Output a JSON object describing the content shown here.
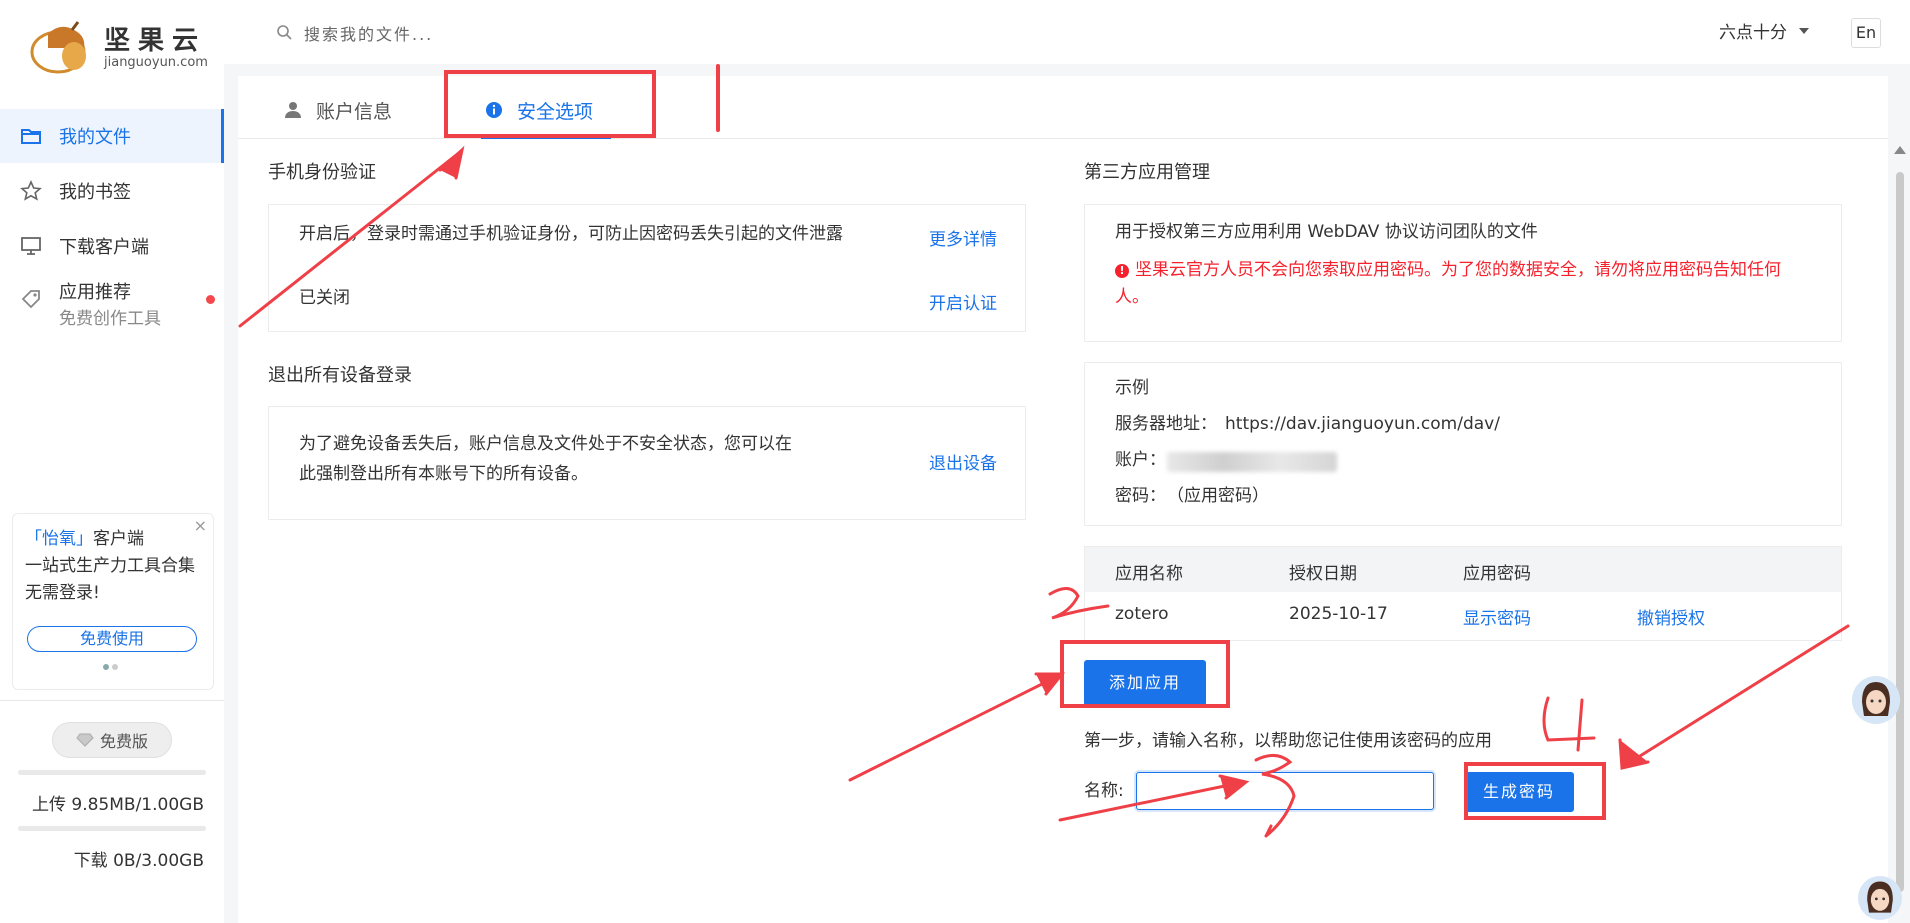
{
  "sidebar": {
    "logo": {
      "cn": "坚果云",
      "en": "jianguoyun.com"
    },
    "items": [
      {
        "label": "我的文件"
      },
      {
        "label": "我的书签"
      },
      {
        "label": "下载客户端"
      },
      {
        "label": "应用推荐",
        "sub": "免费创作工具"
      }
    ],
    "promo": {
      "highlight": "「怡氧」",
      "line1_rest": "客户端",
      "line2": "一站式生产力工具合集 无需登录!",
      "button": "免费使用",
      "close": "×"
    },
    "plan": "免费版",
    "upload": "上传 9.85MB/1.00GB",
    "download": "下载 0B/3.00GB",
    "upload_fraction": 0.0096,
    "download_fraction": 0.0
  },
  "header": {
    "search_placeholder": "搜索我的文件...",
    "user": "六点十分",
    "lang": "En"
  },
  "tabs": [
    {
      "label": "账户信息",
      "icon": "user-icon"
    },
    {
      "label": "安全选项",
      "icon": "info-icon"
    }
  ],
  "phone_auth": {
    "title": "手机身份验证",
    "desc": "开启后，登录时需通过手机验证身份，可防止因密码丢失引起的文件泄露",
    "more": "更多详情",
    "status": "已关闭",
    "enable": "开启认证"
  },
  "logout_all": {
    "title": "退出所有设备登录",
    "desc_line1": "为了避免设备丢失后，账户信息及文件处于不安全状态，您可以在",
    "desc_line2": "此强制登出所有本账号下的所有设备。",
    "action": "退出设备"
  },
  "third_party": {
    "title": "第三方应用管理",
    "desc": "用于授权第三方应用利用 WebDAV 协议访问团队的文件",
    "warning_line1": "坚果云官方人员不会向您索取应用密码。为了您的数据安全，请勿将应用密码告知任何",
    "warning_line2": "人。",
    "example": {
      "title": "示例",
      "server_label": "服务器地址：",
      "server": "https://dav.jianguoyun.com/dav/",
      "account_label": "账户：",
      "password_label": "密码：",
      "password_value": "（应用密码）"
    },
    "table": {
      "headers": [
        "应用名称",
        "授权日期",
        "应用密码"
      ],
      "rows": [
        {
          "name": "zotero",
          "date": "2025-10-17",
          "show": "显示密码",
          "revoke": "撤销授权"
        }
      ]
    },
    "add_button": "添加应用",
    "step_text": "第一步，请输入名称，以帮助您记住使用该密码的应用",
    "name_label": "名称:",
    "name_value": "",
    "generate_button": "生成密码"
  },
  "colors": {
    "accent": "#1a73e8",
    "annotation": "#ef3f47",
    "warning": "#f5222d"
  }
}
